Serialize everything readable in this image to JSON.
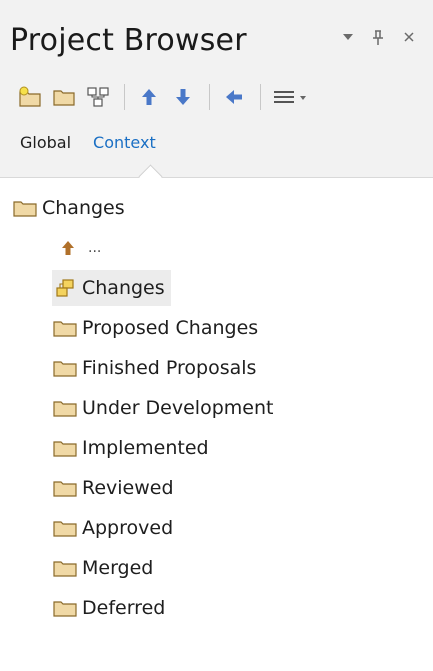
{
  "panel": {
    "title": "Project Browser",
    "controls": {
      "menu_icon": "chevron-down-icon",
      "pin_icon": "pin-icon",
      "close_icon": "close-icon"
    }
  },
  "toolbar": {
    "buttons": [
      {
        "icon": "new-package-icon"
      },
      {
        "icon": "folder-icon"
      },
      {
        "icon": "diagram-icon"
      },
      {
        "icon": "move-up-icon"
      },
      {
        "icon": "move-down-icon"
      },
      {
        "icon": "navigate-back-icon"
      },
      {
        "icon": "menu-icon"
      }
    ]
  },
  "tabs": [
    {
      "label": "Global",
      "active": false
    },
    {
      "label": "Context",
      "active": true
    }
  ],
  "tree": {
    "root": {
      "label": "Changes",
      "icon": "folder-icon"
    },
    "up_link": {
      "label": "...",
      "icon": "up-arrow-icon"
    },
    "items": [
      {
        "label": "Changes",
        "icon": "package-diagram-icon",
        "selected": true
      },
      {
        "label": "Proposed Changes",
        "icon": "folder-icon"
      },
      {
        "label": "Finished Proposals",
        "icon": "folder-icon"
      },
      {
        "label": "Under Development",
        "icon": "folder-icon"
      },
      {
        "label": "Implemented",
        "icon": "folder-icon"
      },
      {
        "label": "Reviewed",
        "icon": "folder-icon"
      },
      {
        "label": "Approved",
        "icon": "folder-icon"
      },
      {
        "label": "Merged",
        "icon": "folder-icon"
      },
      {
        "label": "Deferred",
        "icon": "folder-icon"
      }
    ]
  },
  "colors": {
    "folder": "#f0d9a6",
    "folder_stroke": "#8a6a2a",
    "arrow": "#4a78c8",
    "tab_active": "#1a6fc4",
    "up_arrow": "#b0702a"
  }
}
